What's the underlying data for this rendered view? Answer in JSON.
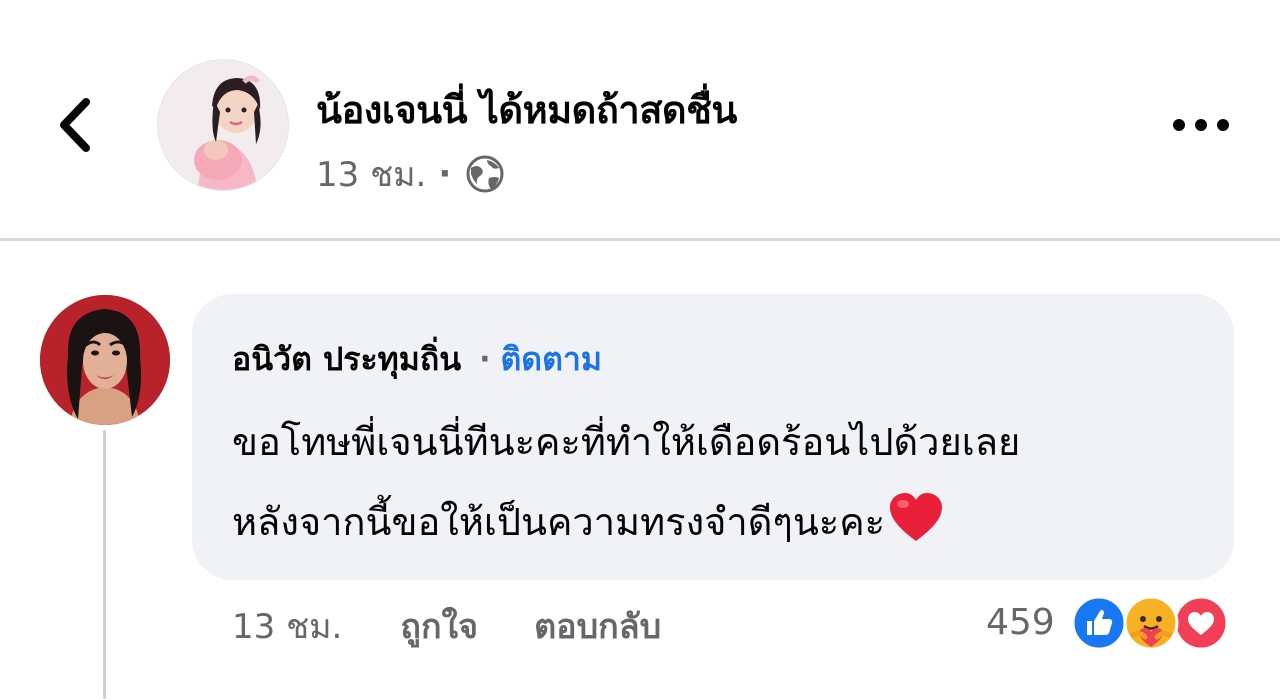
{
  "post": {
    "page_name": "น้องเจนนี่ ได้หมดถ้าสดชื่น",
    "time": "13 ชม.",
    "separator": "·",
    "privacy_icon": "globe-icon",
    "back_icon": "chevron-left-icon",
    "more_icon": "more-horizontal-icon"
  },
  "comment": {
    "author": "อนิวัต ประทุมถิ่น",
    "separator": "·",
    "follow_label": "ติดตาม",
    "text_line1": "ขอโทษพี่เจนนี่ทีนะคะที่ทำให้เดือดร้อนไปด้วยเลย",
    "text_line2": "หลังจากนี้ขอให้เป็นความทรงจำดีๆนะคะ",
    "text_emoji": "red-heart-emoji",
    "time": "13 ชม.",
    "like_label": "ถูกใจ",
    "reply_label": "ตอบกลับ",
    "reaction_count": "459",
    "reactions": [
      "like-reaction-icon",
      "care-reaction-icon",
      "love-reaction-icon"
    ]
  },
  "colors": {
    "link_blue": "#1b74e4",
    "secondary_text": "#65676b",
    "bubble_bg": "#f0f2f5",
    "like_blue": "#1877f2",
    "love_red": "#f33e58",
    "care_yellow": "#f7b125"
  }
}
